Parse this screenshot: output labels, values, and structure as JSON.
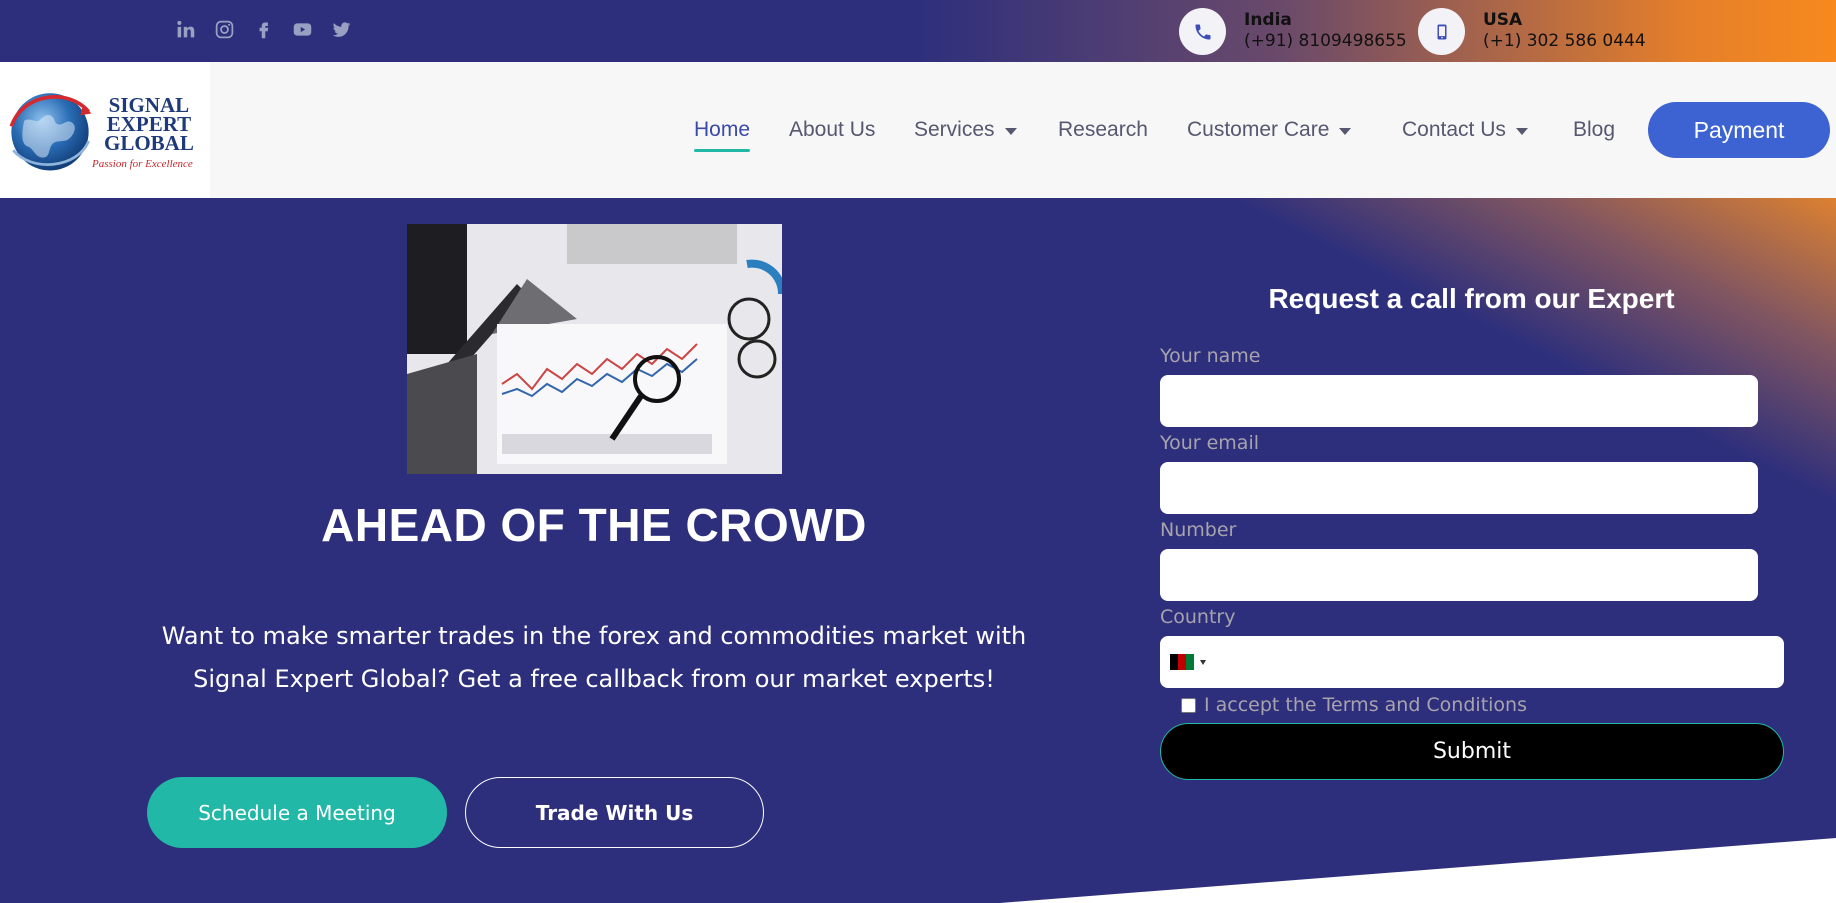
{
  "topbar": {
    "social_icons": [
      "linkedin-icon",
      "instagram-icon",
      "facebook-icon",
      "youtube-icon",
      "twitter-icon"
    ],
    "contacts": [
      {
        "country": "India",
        "number": "(+91) 8109498655",
        "icon": "phone-icon"
      },
      {
        "country": "USA",
        "number": "(+1) 302 586 0444",
        "icon": "mobile-icon"
      }
    ]
  },
  "brand": {
    "line1": "SIGNAL",
    "line2": "EXPERT",
    "line3": "GLOBAL",
    "tagline": "Passion for Excellence"
  },
  "nav": {
    "items": [
      {
        "label": "Home",
        "active": true
      },
      {
        "label": "About Us"
      },
      {
        "label": "Services",
        "dropdown": true
      },
      {
        "label": "Research"
      },
      {
        "label": "Customer Care",
        "dropdown": true
      },
      {
        "label": "Contact Us",
        "dropdown": true
      },
      {
        "label": "Blog"
      }
    ],
    "payment_label": "Payment"
  },
  "hero": {
    "headline": "AHEAD OF THE CROWD",
    "subtext": "Want to make smarter trades in the forex and commodities market with Signal Expert Global? Get a free callback from our market experts!",
    "primary_button": "Schedule a Meeting",
    "secondary_button": "Trade With Us"
  },
  "form": {
    "title": "Request a call from our Expert",
    "name_label": "Your name",
    "email_label": "Your email",
    "number_label": "Number",
    "country_label": "Country",
    "terms_label": "I accept the Terms and Conditions",
    "submit_label": "Submit"
  },
  "colors": {
    "brand_navy": "#2e2f7c",
    "accent_orange": "#f7891d",
    "teal": "#22b8a7",
    "payment_blue": "#3d62d2"
  }
}
